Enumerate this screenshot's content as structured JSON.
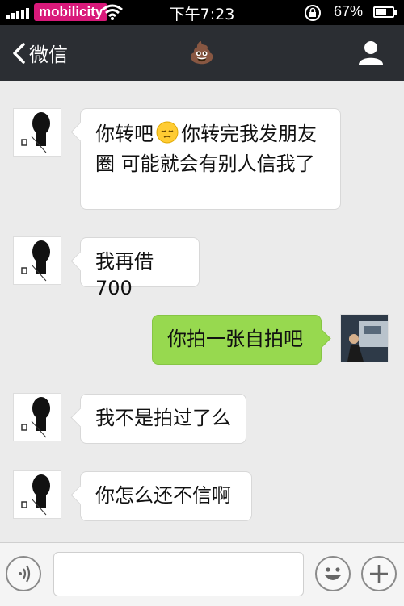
{
  "status_bar": {
    "carrier": "mobilicity",
    "time": "下午7:23",
    "battery_percent": "67%",
    "battery_level": 0.67,
    "icons": [
      "signal-icon",
      "wifi-icon",
      "rotation-lock-icon",
      "battery-icon"
    ]
  },
  "nav": {
    "back_label": "微信",
    "title": "💩",
    "back_icon": "chevron-left-icon",
    "profile_icon": "person-icon"
  },
  "messages": [
    {
      "from": "friend",
      "text_before": "你转吧",
      "emoji": "pensive-face",
      "text_after": "你转完我发朋友圈  可能就会有别人信我了"
    },
    {
      "from": "friend",
      "text": "我再借700"
    },
    {
      "from": "me",
      "text": "你拍一张自拍吧"
    },
    {
      "from": "friend",
      "text": "我不是拍过了么"
    },
    {
      "from": "friend",
      "text": "你怎么还不信啊"
    }
  ],
  "input_bar": {
    "placeholder": "",
    "icons": [
      "voice-icon",
      "emoji-icon",
      "plus-icon"
    ]
  },
  "colors": {
    "nav_bg": "#2b2e33",
    "chat_bg": "#ebebeb",
    "sent_bubble": "#97d94f",
    "received_bubble": "#ffffff",
    "carrier_badge": "#d9197a"
  }
}
